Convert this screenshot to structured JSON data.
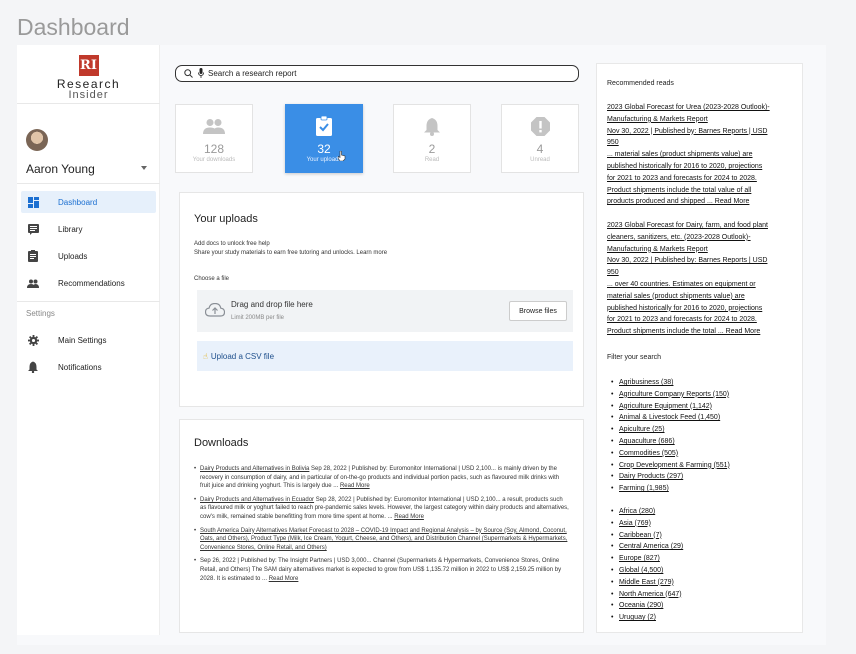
{
  "page": {
    "title": "Dashboard"
  },
  "logo": {
    "mark": "RI",
    "line1": "Research",
    "line2": "Insider"
  },
  "user": {
    "name": "Aaron Young"
  },
  "nav": {
    "items": [
      {
        "label": "Dashboard",
        "icon": "dashboard-icon"
      },
      {
        "label": "Library",
        "icon": "library-icon"
      },
      {
        "label": "Uploads",
        "icon": "uploads-icon"
      },
      {
        "label": "Recommendations",
        "icon": "people-icon"
      }
    ],
    "settings_label": "Settings",
    "settings_items": [
      {
        "label": "Main Settings",
        "icon": "gear-icon"
      },
      {
        "label": "Notifications",
        "icon": "bell-icon"
      }
    ]
  },
  "search": {
    "placeholder": "Search a research report"
  },
  "stats": [
    {
      "value": "128",
      "label": "Your downloads",
      "icon": "people-icon"
    },
    {
      "value": "32",
      "label": "Your uploads",
      "icon": "clipboard-check-icon"
    },
    {
      "value": "2",
      "label": "Read",
      "icon": "bell-icon"
    },
    {
      "value": "4",
      "label": "Unread",
      "icon": "alert-icon"
    }
  ],
  "uploads": {
    "title": "Your uploads",
    "help_line1": "Add docs to unlock free help",
    "help_line2": "Share your study materials to earn free tutoring and unlocks. Learn more",
    "choose_label": "Choose a file",
    "drop_title": "Drag and drop file here",
    "drop_limit": "Limit 200MB per file",
    "browse_label": "Browse files",
    "csv_label": "Upload a CSV file",
    "csv_icon": "☝"
  },
  "downloads": {
    "title": "Downloads",
    "items": [
      {
        "link": "Dairy Products and Alternatives in Bolivia",
        "text": " Sep 28, 2022 | Published by: Euromonitor International | USD 2,100... is mainly driven by the recovery in consumption of dairy, and in particular of on-the-go products and individual portion packs, such as flavoured milk drinks with fruit juice and drinking yoghurt. This is largely due ... ",
        "more": "Read More"
      },
      {
        "link": "Dairy Products and Alternatives in Ecuador",
        "text": " Sep 28, 2022 | Published by: Euromonitor International | USD 2,100... a result, products such as flavoured milk or yoghurt failed to reach pre-pandemic sales levels. However, the largest category within dairy products and alternatives, cow's milk, remained stable benefitting from more time spent at home. ... ",
        "more": "Read More"
      },
      {
        "link": "South America Dairy Alternatives Market Forecast to 2028 – COVID-19 Impact and Regional Analysis – by Source (Soy, Almond, Coconut, Oats, and Others), Product Type (Milk, Ice Cream, Yogurt, Cheese, and Others), and Distribution Channel (Supermarkets & Hypermarkets, Convenience Stores, Online Retail, and Others)",
        "text": "",
        "more": ""
      },
      {
        "link": "",
        "text": "Sep 26, 2022 | Published by: The Insight Partners | USD 3,000... Channel (Supermarkets & Hypermarkets, Convenience Stores, Online Retail, and Others) The SAM dairy alternatives market is expected to grow from US$ 1,135.72 million in 2022 to US$ 2,159.25 million by 2028. It is estimated to ... ",
        "more": "Read More"
      }
    ]
  },
  "recommended": {
    "title": "Recommended reads",
    "items": [
      {
        "lines": [
          "2023 Global Forecast for Urea (2023-2028 Outlook)-",
          "Manufacturing & Markets Report",
          "Nov 30, 2022 | Published by: Barnes Reports | USD",
          "950",
          "... material sales (product shipments value) are",
          "published historically for 2016 to 2020, projections",
          "for 2021 to 2023 and forecasts for 2024 to 2028.",
          "Product shipments include the total value of all",
          "products produced and shipped ... Read More"
        ]
      },
      {
        "lines": [
          "2023 Global Forecast for Dairy, farm, and food plant",
          "cleaners, sanitizers, etc. (2023-2028 Outlook)-",
          "Manufacturing & Markets Report",
          "Nov 30, 2022 | Published by: Barnes Reports | USD",
          "950",
          "... over 40 countries. Estimates on equipment or",
          "material sales (product shipments value) are",
          "published historically for 2016 to 2020, projections",
          "for 2021 to 2023 and forecasts for 2024 to 2028.",
          "Product shipments include the total ... Read More"
        ]
      }
    ]
  },
  "filter": {
    "title": "Filter your search",
    "industries": [
      "Agribusiness (38)",
      "Agriculture Company Reports (150)",
      "Agriculture Equipment (1,142)",
      "Animal & Livestock Feed (1,450)",
      "Apiculture (25)",
      "Aquaculture (686)",
      "Commodities (505)",
      "Crop Development & Farming (551)",
      "Dairy Products (297)",
      "Farming (1,985)"
    ],
    "regions": [
      "Africa (280)",
      "Asia (769)",
      "Caribbean (7)",
      "Central America (29)",
      "Europe (827)",
      "Global (4,500)",
      "Middle East (279)",
      "North America (647)",
      "Oceania (290)",
      "Uruguay (2)"
    ]
  }
}
